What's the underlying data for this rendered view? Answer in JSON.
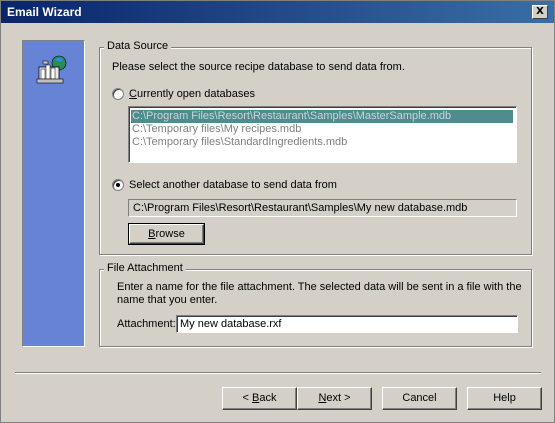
{
  "window": {
    "title": "Email Wizard",
    "close_glyph": "X"
  },
  "data_source": {
    "group_label": "Data Source",
    "instruction": "Please select the source recipe database to send data from.",
    "radio_open": {
      "prefix": "",
      "underlined": "C",
      "rest": "urrently open databases",
      "checked": false
    },
    "open_databases": [
      "C:\\Program Files\\Resort\\Restaurant\\Samples\\MasterSample.mdb",
      "C:\\Temporary files\\My recipes.mdb",
      "C:\\Temporary files\\StandardIngredients.mdb"
    ],
    "radio_another": {
      "label": "Select another database to send data from",
      "checked": true
    },
    "selected_path": "C:\\Program Files\\Resort\\Restaurant\\Samples\\My new database.mdb",
    "browse_button": {
      "underlined": "B",
      "rest": "rowse"
    }
  },
  "file_attachment": {
    "group_label": "File Attachment",
    "instruction_line1": "Enter a name for the file attachment.  The selected data will be sent in a file with the",
    "instruction_line2": "name that you enter.",
    "field_label": "Attachment:",
    "value": "My new database.rxf"
  },
  "footer": {
    "back": {
      "prefix": "< ",
      "underlined": "B",
      "rest": "ack"
    },
    "next": {
      "underlined": "N",
      "rest": "ext >"
    },
    "cancel": "Cancel",
    "help": "Help"
  },
  "icons": {
    "side": "computer-email-icon"
  },
  "colors": {
    "titlebar": "#0a246a",
    "side_panel": "#6683d6",
    "selected_item": "#4e8c8e"
  }
}
